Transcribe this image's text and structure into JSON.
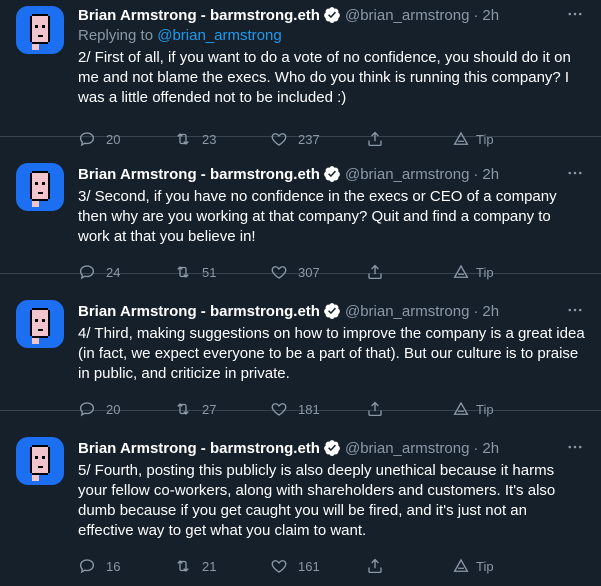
{
  "tweets": [
    {
      "author_name": "Brian Armstrong - barmstrong.eth",
      "handle": "@brian_armstrong",
      "separator": "·",
      "time": "2h",
      "replying_prefix": "Replying to ",
      "replying_to": "@brian_armstrong",
      "text": "2/ First of all, if you want to do a vote of no confidence, you should do it on me and not blame the execs. Who do you think is running this company? I was a little offended not to be included :)",
      "replies": "20",
      "retweets": "23",
      "likes": "237",
      "tip_label": "Tip"
    },
    {
      "author_name": "Brian Armstrong - barmstrong.eth",
      "handle": "@brian_armstrong",
      "separator": "·",
      "time": "2h",
      "text": "3/ Second, if you have no confidence in the execs or CEO of a company then why are you working at that company? Quit and find a company to work at that you believe in!",
      "replies": "24",
      "retweets": "51",
      "likes": "307",
      "tip_label": "Tip"
    },
    {
      "author_name": "Brian Armstrong - barmstrong.eth",
      "handle": "@brian_armstrong",
      "separator": "·",
      "time": "2h",
      "text": "4/ Third, making suggestions on how to improve the company is a great idea (in fact, we expect everyone to be a part of that). But our culture is to praise in public, and criticize in private.",
      "replies": "20",
      "retweets": "27",
      "likes": "181",
      "tip_label": "Tip"
    },
    {
      "author_name": "Brian Armstrong - barmstrong.eth",
      "handle": "@brian_armstrong",
      "separator": "·",
      "time": "2h",
      "text": "5/ Fourth, posting this publicly is also deeply unethical because it harms your fellow co-workers, along with shareholders and customers. It's also dumb because if you get caught you will be fired, and it's just not an effective way to get what you claim to want.",
      "replies": "16",
      "retweets": "21",
      "likes": "161",
      "tip_label": "Tip"
    }
  ],
  "colors": {
    "background": "#15202b",
    "text": "#ffffff",
    "secondary": "#8b98a5",
    "link": "#1d9bf0",
    "divider": "#38444d",
    "avatar_bg": "#1d6ff2"
  },
  "icons": [
    "avatar",
    "verified-badge-icon",
    "more-icon",
    "reply-icon",
    "retweet-icon",
    "like-icon",
    "share-icon",
    "tip-icon"
  ]
}
